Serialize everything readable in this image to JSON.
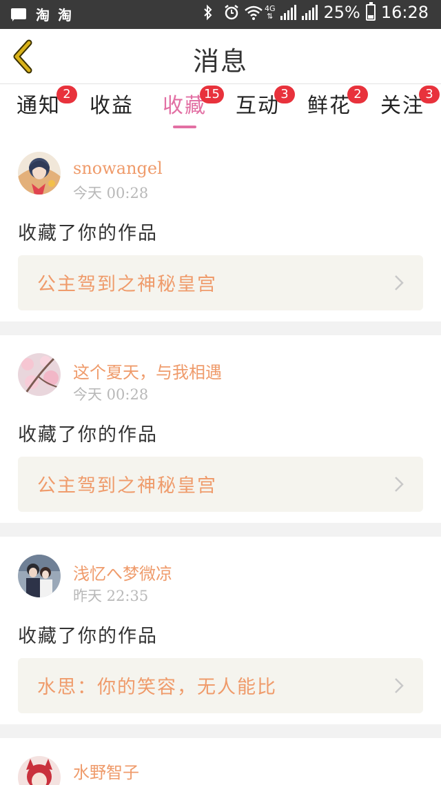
{
  "status_bar": {
    "left_apps": [
      "淘",
      "淘"
    ],
    "network": "4G",
    "battery": "25%",
    "battery_level": 0.25,
    "time": "16:28"
  },
  "header": {
    "title": "消息"
  },
  "tabs": [
    {
      "label": "通知",
      "badge": "2",
      "active": false
    },
    {
      "label": "收益",
      "badge": "",
      "active": false
    },
    {
      "label": "收藏",
      "badge": "15",
      "active": true
    },
    {
      "label": "互动",
      "badge": "3",
      "active": false
    },
    {
      "label": "鲜花",
      "badge": "2",
      "active": false
    },
    {
      "label": "关注",
      "badge": "3",
      "active": false
    }
  ],
  "messages": [
    {
      "user": "snowangel",
      "time": "今天 00:28",
      "action": "收藏了你的作品",
      "work": "公主驾到之神秘皇宫"
    },
    {
      "user": "这个夏天，与我相遇",
      "time": "今天 00:28",
      "action": "收藏了你的作品",
      "work": "公主驾到之神秘皇宫"
    },
    {
      "user": "浅忆へ梦微凉",
      "time": "昨天 22:35",
      "action": "收藏了你的作品",
      "work": "水思：你的笑容，无人能比"
    },
    {
      "user": "水野智子",
      "time": "",
      "action": "",
      "work": ""
    }
  ],
  "colors": {
    "accent_pink": "#e26fa3",
    "badge_red": "#e8323c",
    "name_orange": "#ef9b6b",
    "card_bg": "#f5f4ee",
    "back_arrow": "#d9b21a"
  }
}
